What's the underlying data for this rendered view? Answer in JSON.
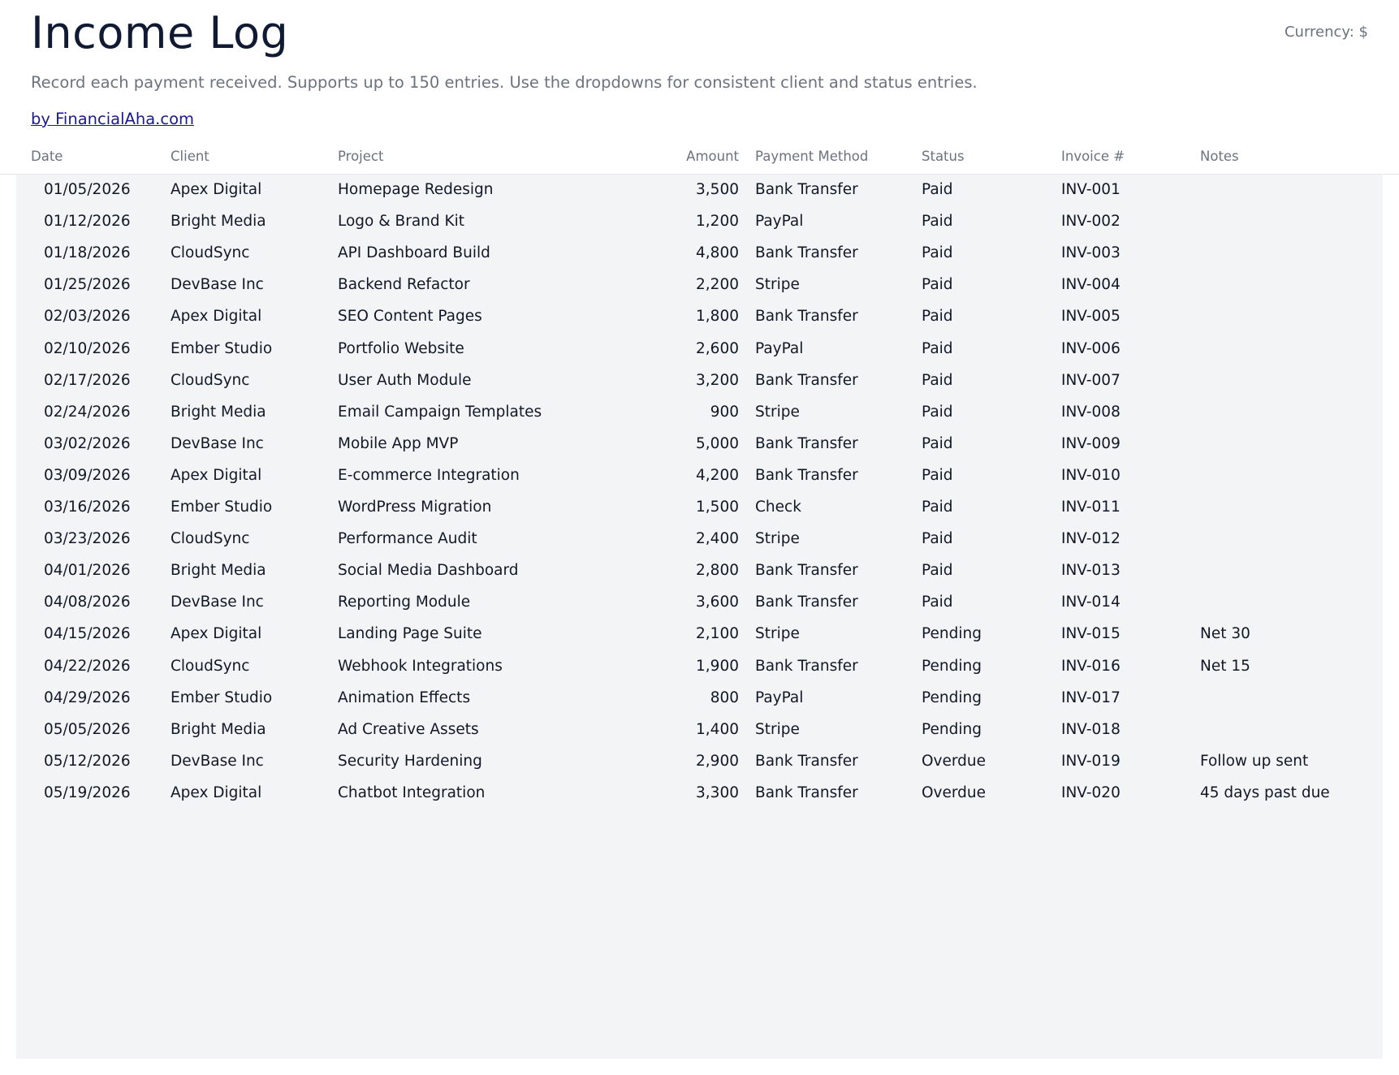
{
  "header": {
    "title": "Income Log",
    "currency_label": "Currency: $",
    "subtitle": "Record each payment received. Supports up to 150 entries. Use the dropdowns for consistent client and status entries.",
    "credit_link": "by FinancialAha.com"
  },
  "table": {
    "columns": [
      "Date",
      "Client",
      "Project",
      "Amount",
      "Payment Method",
      "Status",
      "Invoice #",
      "Notes"
    ],
    "rows": [
      [
        "01/05/2026",
        "Apex Digital",
        "Homepage Redesign",
        "3,500",
        "Bank Transfer",
        "Paid",
        "INV-001",
        ""
      ],
      [
        "01/12/2026",
        "Bright Media",
        "Logo & Brand Kit",
        "1,200",
        "PayPal",
        "Paid",
        "INV-002",
        ""
      ],
      [
        "01/18/2026",
        "CloudSync",
        "API Dashboard Build",
        "4,800",
        "Bank Transfer",
        "Paid",
        "INV-003",
        ""
      ],
      [
        "01/25/2026",
        "DevBase Inc",
        "Backend Refactor",
        "2,200",
        "Stripe",
        "Paid",
        "INV-004",
        ""
      ],
      [
        "02/03/2026",
        "Apex Digital",
        "SEO Content Pages",
        "1,800",
        "Bank Transfer",
        "Paid",
        "INV-005",
        ""
      ],
      [
        "02/10/2026",
        "Ember Studio",
        "Portfolio Website",
        "2,600",
        "PayPal",
        "Paid",
        "INV-006",
        ""
      ],
      [
        "02/17/2026",
        "CloudSync",
        "User Auth Module",
        "3,200",
        "Bank Transfer",
        "Paid",
        "INV-007",
        ""
      ],
      [
        "02/24/2026",
        "Bright Media",
        "Email Campaign Templates",
        "900",
        "Stripe",
        "Paid",
        "INV-008",
        ""
      ],
      [
        "03/02/2026",
        "DevBase Inc",
        "Mobile App MVP",
        "5,000",
        "Bank Transfer",
        "Paid",
        "INV-009",
        ""
      ],
      [
        "03/09/2026",
        "Apex Digital",
        "E-commerce Integration",
        "4,200",
        "Bank Transfer",
        "Paid",
        "INV-010",
        ""
      ],
      [
        "03/16/2026",
        "Ember Studio",
        "WordPress Migration",
        "1,500",
        "Check",
        "Paid",
        "INV-011",
        ""
      ],
      [
        "03/23/2026",
        "CloudSync",
        "Performance Audit",
        "2,400",
        "Stripe",
        "Paid",
        "INV-012",
        ""
      ],
      [
        "04/01/2026",
        "Bright Media",
        "Social Media Dashboard",
        "2,800",
        "Bank Transfer",
        "Paid",
        "INV-013",
        ""
      ],
      [
        "04/08/2026",
        "DevBase Inc",
        "Reporting Module",
        "3,600",
        "Bank Transfer",
        "Paid",
        "INV-014",
        ""
      ],
      [
        "04/15/2026",
        "Apex Digital",
        "Landing Page Suite",
        "2,100",
        "Stripe",
        "Pending",
        "INV-015",
        "Net 30"
      ],
      [
        "04/22/2026",
        "CloudSync",
        "Webhook Integrations",
        "1,900",
        "Bank Transfer",
        "Pending",
        "INV-016",
        "Net 15"
      ],
      [
        "04/29/2026",
        "Ember Studio",
        "Animation Effects",
        "800",
        "PayPal",
        "Pending",
        "INV-017",
        ""
      ],
      [
        "05/05/2026",
        "Bright Media",
        "Ad Creative Assets",
        "1,400",
        "Stripe",
        "Pending",
        "INV-018",
        ""
      ],
      [
        "05/12/2026",
        "DevBase Inc",
        "Security Hardening",
        "2,900",
        "Bank Transfer",
        "Overdue",
        "INV-019",
        "Follow up sent"
      ],
      [
        "05/19/2026",
        "Apex Digital",
        "Chatbot Integration",
        "3,300",
        "Bank Transfer",
        "Overdue",
        "INV-020",
        "45 days past due"
      ]
    ]
  },
  "colors": {
    "title": "#111a33",
    "muted_text": "#6b7280",
    "link": "#1a1a8c",
    "table_background": "#f3f4f6"
  }
}
